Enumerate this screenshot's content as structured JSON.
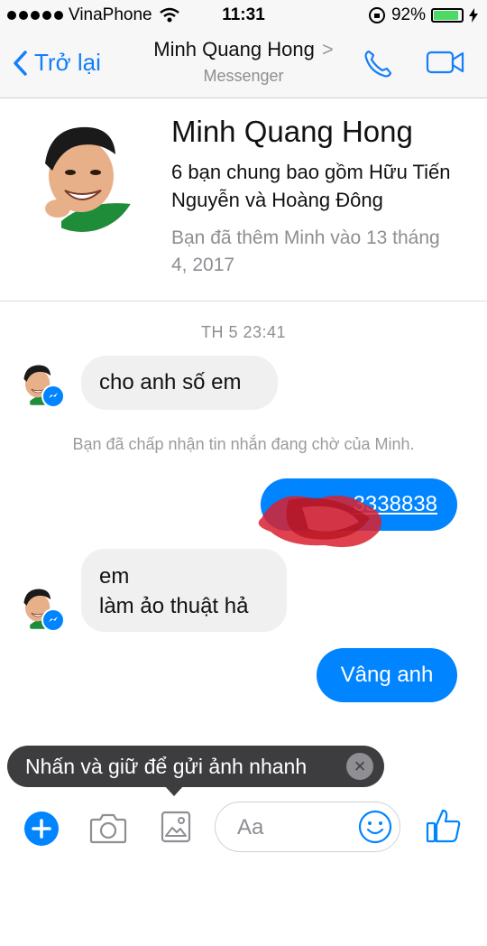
{
  "status": {
    "carrier": "VinaPhone",
    "time": "11:31",
    "battery": "92%",
    "battery_level": 0.92
  },
  "nav": {
    "back_label": "Trở lại",
    "title": "Minh Quang Hong",
    "chevron": ">",
    "subtitle": "Messenger"
  },
  "profile": {
    "name": "Minh Quang Hong",
    "mutual": "6 bạn chung bao gồm Hữu Tiến Nguyễn và Hoàng Đông",
    "added": "Bạn đã thêm Minh vào 13 tháng 4, 2017"
  },
  "thread": {
    "timestamp": "TH 5 23:41",
    "msg1": "cho anh số em",
    "system_note": "Bạn đã chấp nhận tin nhắn đang chờ của Minh.",
    "outgoing_phone": "3338838",
    "msg3_line1": "em",
    "msg3_line2": "làm ảo thuật hả",
    "outgoing_reply": "Vâng anh"
  },
  "tooltip": {
    "text": "Nhấn và giữ để gửi ảnh nhanh",
    "close": "×"
  },
  "composer": {
    "placeholder": "Aa"
  },
  "colors": {
    "accent": "#0084ff",
    "ios_blue": "#147efb",
    "bubble_in": "#f1f0f0"
  }
}
